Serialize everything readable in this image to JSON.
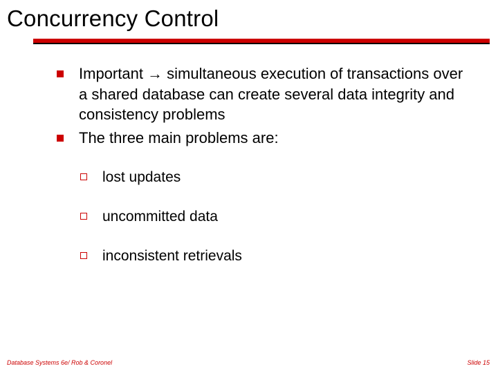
{
  "title": "Concurrency Control",
  "bullets": [
    "Important → simultaneous execution of transactions over a shared database can create several data integrity and consistency problems",
    "The three main problems are:"
  ],
  "subbullets": [
    "lost updates",
    "uncommitted data",
    "inconsistent retrievals"
  ],
  "footer": {
    "left": "Database Systems 6e/ Rob & Coronel",
    "right": "Slide 15"
  },
  "colors": {
    "accent": "#cc0000"
  }
}
